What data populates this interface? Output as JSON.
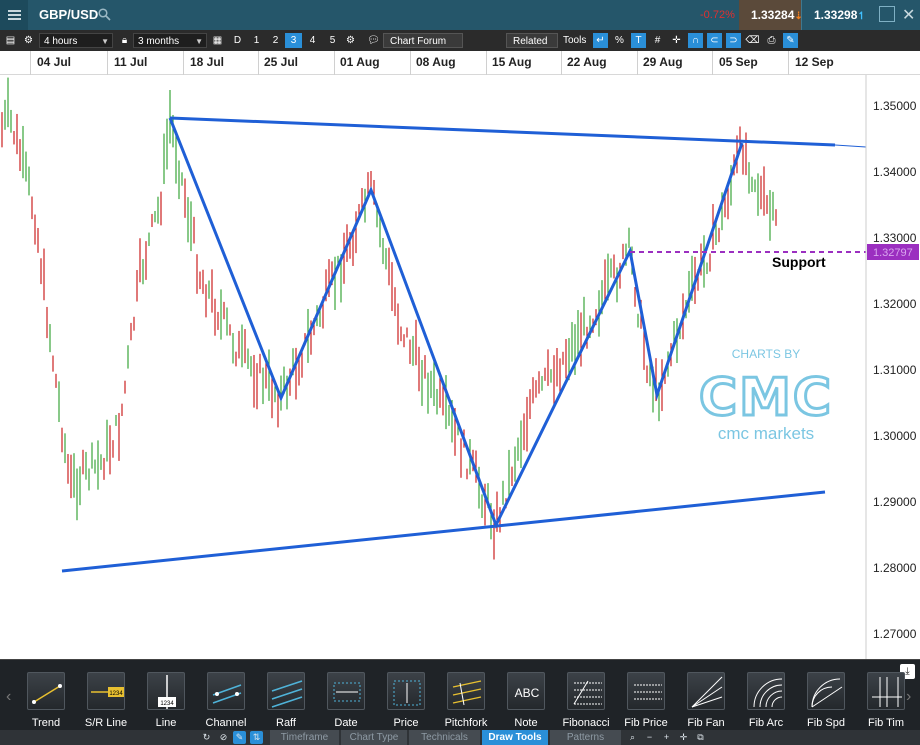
{
  "header": {
    "symbol": "GBP/USD",
    "change_pct": "-0.72%",
    "sell_price": "1.33284",
    "buy_price": "1.33298"
  },
  "toolbar": {
    "interval": "4 hours",
    "range": "3 months",
    "day_btn": "D",
    "levels": [
      "1",
      "2",
      "3",
      "4",
      "5"
    ],
    "active_level": "3",
    "chart_forum": "Chart Forum",
    "related": "Related",
    "tools": "Tools",
    "percent": "%"
  },
  "date_axis": {
    "labels": [
      "04 Jul",
      "11 Jul",
      "18 Jul",
      "25 Jul",
      "01 Aug",
      "08 Aug",
      "15 Aug",
      "22 Aug",
      "29 Aug",
      "05 Sep",
      "12 Sep"
    ]
  },
  "chart": {
    "price_labels": [
      "1.35000",
      "1.34000",
      "1.33000",
      "1.32000",
      "1.31000",
      "1.30000",
      "1.29000",
      "1.28000",
      "1.27000"
    ],
    "current_price_tag": "1.32797",
    "support_label": "Support",
    "watermark_top": "CHARTS BY",
    "watermark_logo": "CMC",
    "watermark_bottom": "cmc markets",
    "colors": {
      "up": "#3aa53a",
      "down": "#cc2020",
      "trendline": "#1f5fd6",
      "support": "#9b2fc0"
    }
  },
  "chart_data": {
    "type": "candlestick",
    "symbol": "GBP/USD",
    "interval": "4 hours",
    "y_range": [
      1.265,
      1.3525
    ],
    "current_price": 1.32797,
    "support_level": 1.32797,
    "trendlines": [
      {
        "name": "upper",
        "from": [
          "12 Jul",
          1.3482
        ],
        "to": [
          "12 Sep",
          1.344
        ]
      },
      {
        "name": "lower",
        "from": [
          "29 Jun",
          1.2795
        ],
        "to": [
          "09 Sep",
          1.2915
        ]
      }
    ],
    "zigzag": [
      [
        "12 Jul",
        1.3482
      ],
      [
        "27 Jul",
        1.3058
      ],
      [
        "06 Aug",
        1.337
      ],
      [
        "17 Aug",
        1.2862
      ],
      [
        "30 Aug",
        1.328
      ],
      [
        "03 Sep",
        1.306
      ],
      [
        "08 Sep",
        1.3445
      ]
    ]
  },
  "draw_tools": {
    "tools": [
      "Trend",
      "S/R Line",
      "Line",
      "Channel",
      "Raff",
      "Date",
      "Price",
      "Pitchfork",
      "Note",
      "Fibonacci",
      "Fib Price",
      "Fib Fan",
      "Fib Arc",
      "Fib Spd",
      "Fib Tim"
    ],
    "sr_badge": "1234",
    "line_badge": "1234",
    "note_badge": "ABC"
  },
  "tabs": {
    "items": [
      "Timeframe",
      "Chart Type",
      "Technicals",
      "Draw Tools",
      "Patterns"
    ],
    "active": "Draw Tools"
  }
}
